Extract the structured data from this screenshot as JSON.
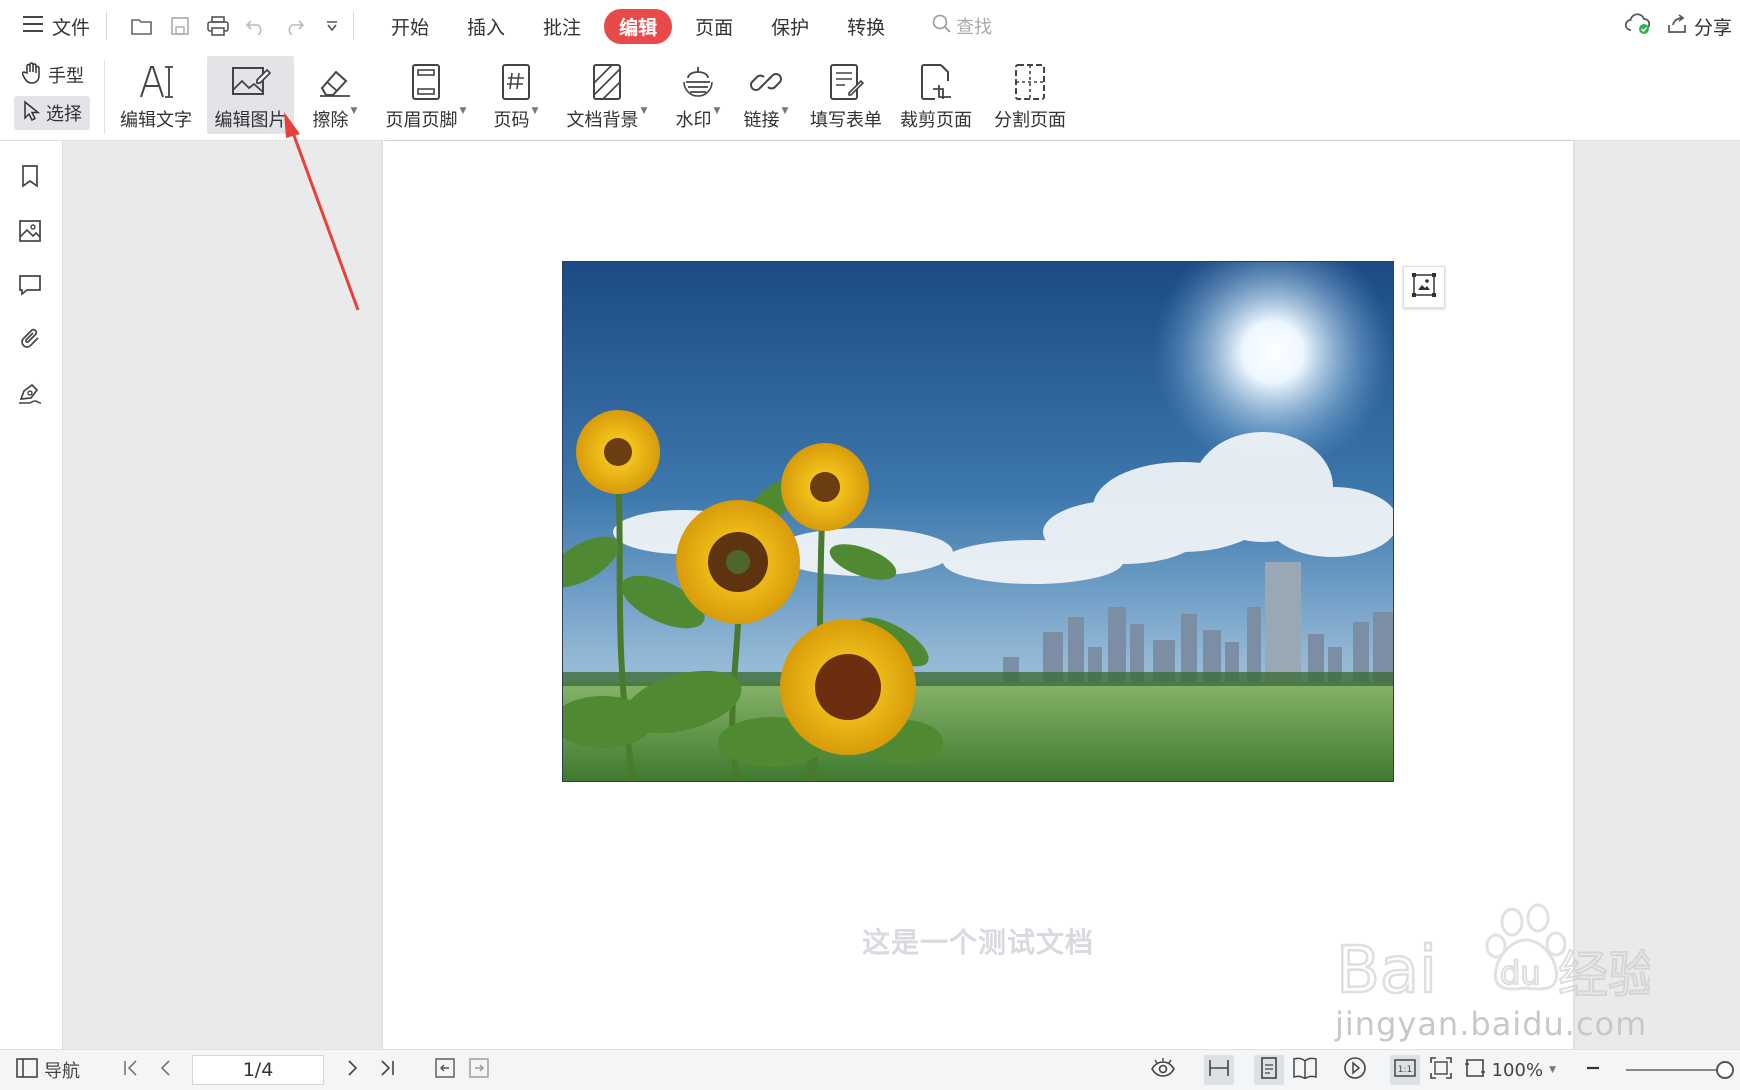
{
  "titlebar": {
    "file_label": "文件",
    "tabs": [
      {
        "label": "开始"
      },
      {
        "label": "插入"
      },
      {
        "label": "批注"
      },
      {
        "label": "编辑"
      },
      {
        "label": "页面"
      },
      {
        "label": "保护"
      },
      {
        "label": "转换"
      }
    ],
    "active_tab": "编辑",
    "search_placeholder": "查找",
    "share_label": "分享"
  },
  "ribbon": {
    "mode_hand": "手型",
    "mode_select": "选择",
    "tools": [
      {
        "label": "编辑文字",
        "icon": "edit-text-icon"
      },
      {
        "label": "编辑图片",
        "icon": "edit-image-icon"
      },
      {
        "label": "擦除",
        "icon": "eraser-icon"
      },
      {
        "label": "页眉页脚",
        "icon": "header-footer-icon"
      },
      {
        "label": "页码",
        "icon": "page-number-icon"
      },
      {
        "label": "文档背景",
        "icon": "document-background-icon"
      },
      {
        "label": "水印",
        "icon": "watermark-icon"
      },
      {
        "label": "链接",
        "icon": "link-icon"
      },
      {
        "label": "填写表单",
        "icon": "fill-form-icon"
      },
      {
        "label": "裁剪页面",
        "icon": "crop-page-icon"
      },
      {
        "label": "分割页面",
        "icon": "split-page-icon"
      }
    ]
  },
  "document": {
    "caption": "这是一个测试文档"
  },
  "statusbar": {
    "nav_label": "导航",
    "page_indicator": "1/4",
    "zoom": "100%"
  },
  "watermark": {
    "brand": "Baidu经验",
    "domain": "jingyan.baidu.com"
  },
  "colors": {
    "accent": "#e84a4a",
    "annotation_arrow": "#e8403a"
  }
}
